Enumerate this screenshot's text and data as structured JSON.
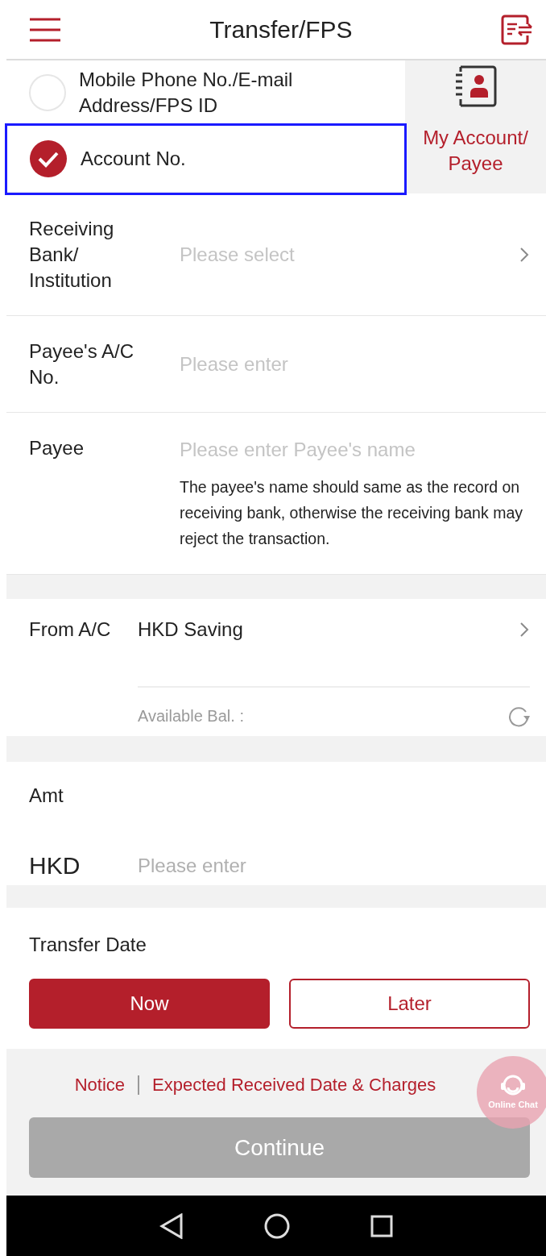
{
  "header": {
    "title": "Transfer/FPS"
  },
  "recipient_types": [
    {
      "label": "Mobile Phone No./E-mail Address/FPS ID",
      "selected": false,
      "highlighted": false
    },
    {
      "label": "Account No.",
      "selected": true,
      "highlighted": true
    }
  ],
  "payee_shortcut": {
    "label": "My Account/ Payee"
  },
  "fields": [
    {
      "kind": "select",
      "label": "Receiving Bank/ Institution",
      "placeholder": "Please select"
    },
    {
      "kind": "input",
      "label": "Payee's A/C No.",
      "placeholder": "Please enter"
    },
    {
      "kind": "input",
      "label": "Payee",
      "placeholder": "Please enter Payee's name",
      "note": "The payee's name should same as the record on receiving bank, otherwise the receiving bank may reject the transaction."
    }
  ],
  "from_account": {
    "label": "From A/C",
    "value": "HKD Saving",
    "balance_label": "Available Bal. :"
  },
  "amount": {
    "label": "Amt",
    "currency": "HKD",
    "placeholder": "Please enter"
  },
  "transfer_date": {
    "label": "Transfer Date",
    "options": [
      {
        "label": "Now",
        "selected": true
      },
      {
        "label": "Later",
        "selected": false
      }
    ]
  },
  "footer_links": [
    "Notice",
    "Expected Received Date & Charges"
  ],
  "continue_button": {
    "label": "Continue",
    "disabled": true
  },
  "online_chat": {
    "label": "Online Chat"
  }
}
